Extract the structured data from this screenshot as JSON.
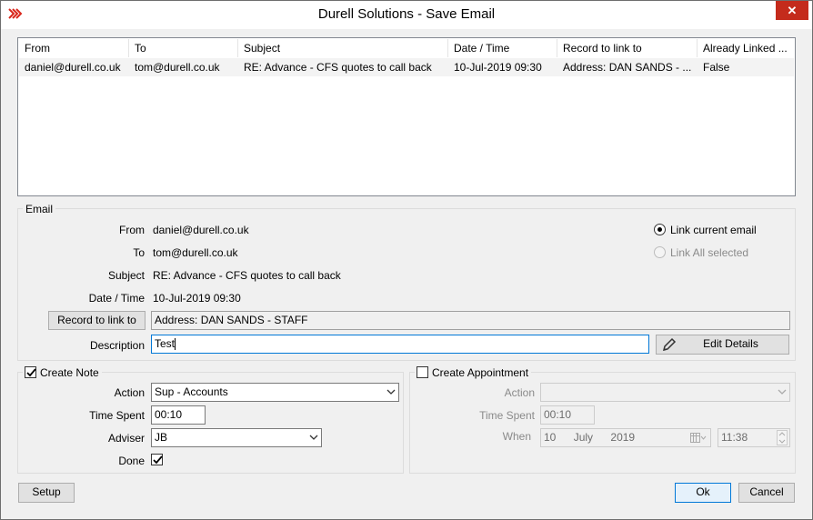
{
  "window": {
    "title": "Durell Solutions - Save Email",
    "close_glyph": "✕",
    "app_icon": "durell-logo-icon"
  },
  "email_list": {
    "columns": [
      "From",
      "To",
      "Subject",
      "Date / Time",
      "Record to link to",
      "Already Linked ..."
    ],
    "rows": [
      [
        "daniel@durell.co.uk",
        "tom@durell.co.uk",
        "RE: Advance - CFS quotes to call back",
        "10-Jul-2019 09:30",
        "Address: DAN SANDS - ...",
        "False"
      ]
    ]
  },
  "email": {
    "group_label": "Email",
    "from_label": "From",
    "from_value": "daniel@durell.co.uk",
    "to_label": "To",
    "to_value": "tom@durell.co.uk",
    "subject_label": "Subject",
    "subject_value": "RE: Advance - CFS quotes to call back",
    "datetime_label": "Date / Time",
    "datetime_value": "10-Jul-2019 09:30",
    "record_button": "Record to link to",
    "record_value": "Address: DAN SANDS - STAFF",
    "description_label": "Description",
    "description_value": "Test",
    "edit_details_button": "Edit Details",
    "edit_icon": "pencil-icon",
    "link_current_label": "Link current email",
    "link_current_checked": true,
    "link_all_label": "Link All selected",
    "link_all_enabled": false
  },
  "note": {
    "create_label": "Create Note",
    "create_checked": true,
    "action_label": "Action",
    "action_value": "Sup - Accounts",
    "time_spent_label": "Time Spent",
    "time_spent_value": "00:10",
    "adviser_label": "Adviser",
    "adviser_value": "JB",
    "done_label": "Done",
    "done_checked": true
  },
  "appointment": {
    "create_label": "Create Appointment",
    "create_checked": false,
    "action_label": "Action",
    "action_value": "",
    "time_spent_label": "Time Spent",
    "time_spent_value": "00:10",
    "when_label": "When",
    "when_day": "10",
    "when_month": "July",
    "when_year": "2019",
    "when_time": "11:38",
    "calendar_icon": "calendar-icon"
  },
  "footer": {
    "setup_button": "Setup",
    "ok_button": "Ok",
    "cancel_button": "Cancel"
  },
  "colors": {
    "accent": "#0078d7",
    "close": "#c42b1c",
    "logo": "#d9271c"
  }
}
